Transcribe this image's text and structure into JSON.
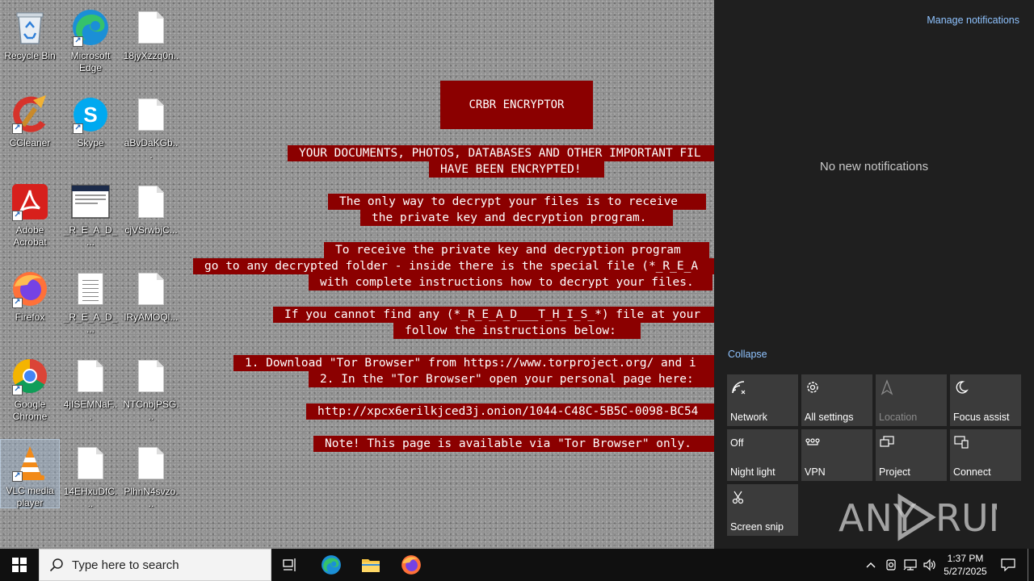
{
  "desktop": {
    "icons": [
      {
        "label": "Recycle Bin"
      },
      {
        "label": "Microsoft Edge"
      },
      {
        "label": "18jyXzzq0n..."
      },
      {
        "label": "CCleaner"
      },
      {
        "label": "Skype"
      },
      {
        "label": "aBvDaKGb..."
      },
      {
        "label": "Adobe Acrobat"
      },
      {
        "label": "_R_E_A_D_..."
      },
      {
        "label": "cjVSrwbjC..."
      },
      {
        "label": "Firefox"
      },
      {
        "label": "_R_E_A_D_..."
      },
      {
        "label": "lRyAMOQl..."
      },
      {
        "label": "Google Chrome"
      },
      {
        "label": "4jISEMNaF..."
      },
      {
        "label": "NTCnbjPSG..."
      },
      {
        "label": "VLC media player"
      },
      {
        "label": "14EHxuDfC..."
      },
      {
        "label": "PlhnN4svzo..."
      }
    ]
  },
  "ransom_note": {
    "title": "CRBR ENCRYPTOR",
    "lines": [
      "YOUR DOCUMENTS, PHOTOS, DATABASES AND OTHER IMPORTANT FIL",
      "HAVE BEEN ENCRYPTED!",
      "The only way to decrypt your files is to receive",
      "the private key and decryption program.",
      "To receive the private key and decryption program",
      "go to any decrypted folder - inside there is the special file (*_R_E_A",
      "with complete instructions how to decrypt your files.",
      "If you cannot find any (*_R_E_A_D___T_H_I_S_*) file at your",
      "follow the instructions below:",
      "1. Download \"Tor Browser\" from https://www.torproject.org/ and i",
      "2. In the \"Tor Browser\" open your personal page here:",
      "http://xpcx6erilkjced3j.onion/1044-C48C-5B5C-0098-BC54",
      "Note! This page is available via \"Tor Browser\" only."
    ]
  },
  "action_center": {
    "manage_label": "Manage notifications",
    "empty_label": "No new notifications",
    "collapse_label": "Collapse",
    "tiles": [
      {
        "label": "Network",
        "icon": "network-icon"
      },
      {
        "label": "All settings",
        "icon": "gear-icon"
      },
      {
        "label": "Location",
        "icon": "location-icon"
      },
      {
        "label": "Focus assist",
        "icon": "moon-icon"
      },
      {
        "label": "Night light",
        "state": "Off",
        "icon": ""
      },
      {
        "label": "VPN",
        "icon": "vpn-icon"
      },
      {
        "label": "Project",
        "icon": "project-icon"
      },
      {
        "label": "Connect",
        "icon": "connect-icon"
      },
      {
        "label": "Screen snip",
        "icon": "screen-snip-icon"
      }
    ]
  },
  "watermark": {
    "text": "ANY RUN"
  },
  "taskbar": {
    "search_placeholder": "Type here to search",
    "time": "1:37 PM",
    "date": "5/27/2025"
  },
  "colors": {
    "ransom_red": "#8b0000",
    "action_center_bg": "#1f1f1f",
    "tile_bg": "#3b3b3b",
    "link_blue": "#8fc3ff",
    "taskbar_bg": "#101010"
  }
}
